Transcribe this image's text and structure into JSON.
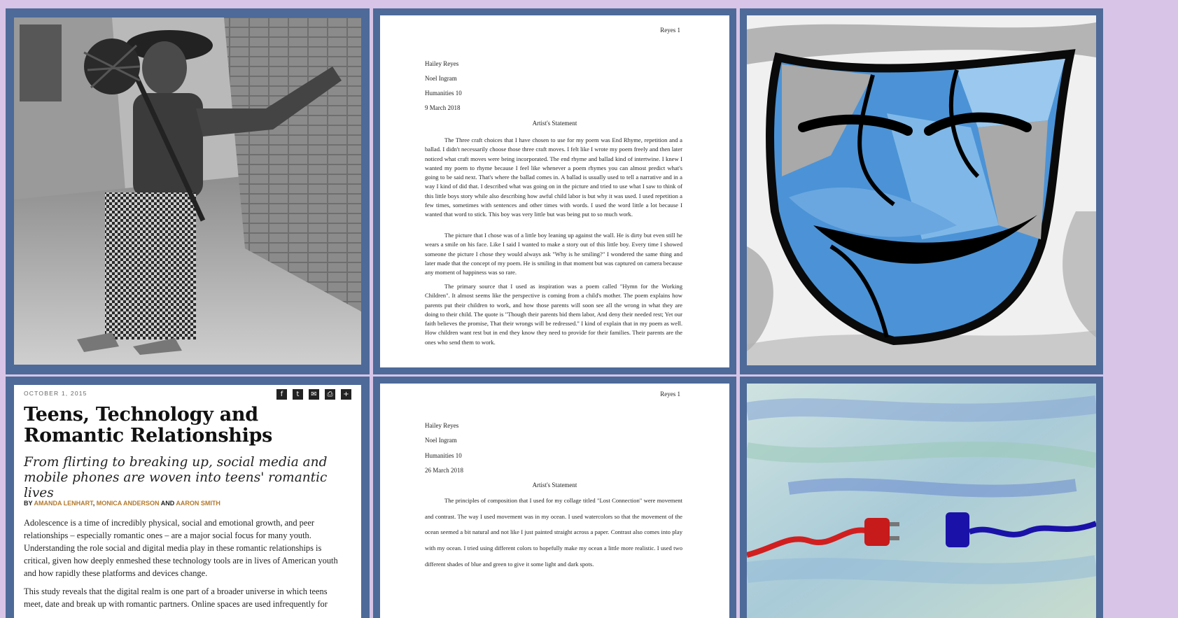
{
  "tiles": {
    "photo": {
      "icon": "chimney-sweep-photo"
    },
    "doc1": {
      "header_right": "Reyes 1",
      "meta": [
        "Hailey Reyes",
        "Noel Ingram",
        "Humanities 10",
        "9 March 2018"
      ],
      "title": "Artist's Statement",
      "paragraphs": [
        "The Three craft choices that I have chosen to use for my poem was End Rhyme, repetition and a ballad. I didn't necessarily choose those three craft moves. I felt like I wrote my poem freely and then later noticed what craft moves were being incorporated. The end rhyme and ballad kind of intertwine. I knew I wanted my poem to rhyme because I feel like whenever a poem rhymes you can almost predict what's going to be said next. That's where the ballad comes in. A ballad is usually used to tell a narrative and in a way I kind of did that. I described what was going on in the picture and tried to use what I saw to think of this little boys story while also describing how awful child labor is but why it was used. I used repetition a few times, sometimes with sentences and other times with words. I used the word little a lot because I wanted that word to stick. This boy was very little but was being put to so much work.",
        "The picture that I chose was of a little boy leaning up against the wall. He is dirty but even still he wears a smile on his face. Like I said I wanted to make a story out of this little boy. Every time I showed someone the picture I chose they would always ask \"Why is he smiling?\" I wondered the same thing and later made that the concept of my poem. He is smiling in that moment but was captured on camera because any moment of happiness was so rare.",
        "The primary source that I used as inspiration was a poem called \"Hymn for the Working Children\". It almost seems like the perspective is coming from a child's mother. The poem explains how parents put their children to work, and how those parents will soon see all the wrong in what they are doing to their child. The quote is \"Though their parents bid them labor, And deny their needed rest; Yet our faith believes the promise, That their wrongs will be redressed.\" I kind of explain that in my poem as well. How children want rest but in end they know they need to provide for their families. Their parents are the ones who send them to work."
      ]
    },
    "painting_mask": {
      "icon": "cracked-mask-painting"
    },
    "article": {
      "date": "OCTOBER 1, 2015",
      "share_icons": [
        "f",
        "t",
        "✉",
        "⎙",
        "+"
      ],
      "headline": "Teens, Technology and Romantic Relationships",
      "subhead": "From flirting to breaking up, social media and mobile phones are woven into teens' romantic lives",
      "by": "BY",
      "authors": [
        "AMANDA LENHART",
        "MONICA ANDERSON",
        "AARON SMITH"
      ],
      "sep1": ", ",
      "sep2": " AND ",
      "para1": "Adolescence is a time of incredibly physical, social and emotional growth, and peer relationships – especially romantic ones – are a major social focus for many youth. Understanding the role social and digital media play in these romantic relationships is critical, given how deeply enmeshed these technology tools are in lives of American youth and how rapidly these platforms and devices change.",
      "para2": "This study reveals that the digital realm is one part of a broader universe in which teens meet, date and break up with romantic partners. Online spaces are used infrequently for"
    },
    "doc2": {
      "header_right": "Reyes 1",
      "meta": [
        "Hailey Reyes",
        "Noel Ingram",
        "Humanities 10",
        "26 March 2018"
      ],
      "title": "Artist's Statement",
      "paragraphs": [
        "The principles of composition that I used for my collage titled \"Lost Connection\" were movement and contrast. The way I used movement was in my ocean. I used watercolors so that the movement of the ocean seemed a bit natural and not like I just painted straight across a paper. Contrast also comes into play with my ocean. I tried using different colors to hopefully make my ocean a little more realistic. I used two different shades of blue and green to give it some light and dark spots."
      ]
    },
    "painting_plugs": {
      "icon": "unplugged-cords-painting"
    }
  }
}
